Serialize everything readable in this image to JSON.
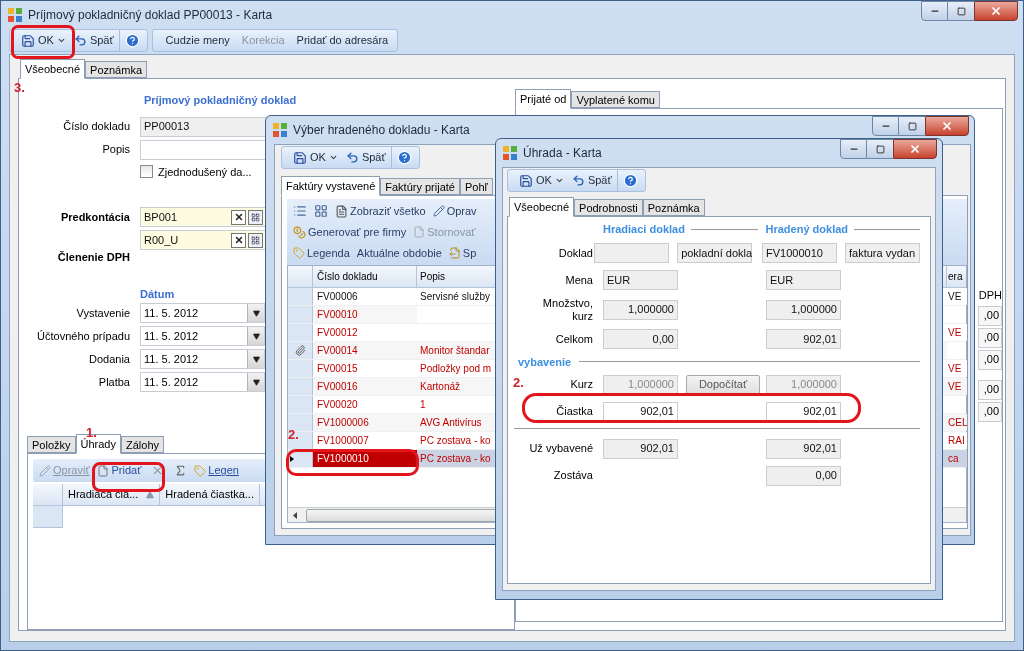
{
  "main_window": {
    "title": "Príjmový pokladničný doklad PP00013 - Karta",
    "toolbar": [
      [
        {
          "kind": "save",
          "label": "OK"
        },
        {
          "kind": "undo",
          "label": "Späť"
        },
        {
          "kind": "help"
        }
      ],
      [
        {
          "kind": "text",
          "label": "Cudzie meny",
          "disabled": false
        },
        {
          "kind": "text",
          "label": "Korekcia",
          "disabled": true
        },
        {
          "kind": "text",
          "label": "Pridať do adresára",
          "disabled": false
        }
      ]
    ],
    "tabs": [
      {
        "label": "Všeobecné",
        "selected": true
      },
      {
        "label": "Poznámka",
        "selected": false
      }
    ],
    "section_title": "Príjmový pokladničný doklad",
    "fields": [
      {
        "label": "Číslo dokladu",
        "value": "PP00013",
        "editable": false
      },
      {
        "label": "Popis",
        "editable": true
      }
    ],
    "checkbox": {
      "label": "Zjednodušený da...",
      "checked": false
    },
    "predkontacia": {
      "label": "Predkontácia",
      "values": [
        "BP001",
        "R00_U"
      ]
    },
    "clenenie_label": "Členenie DPH",
    "dates": {
      "title": "Dátum",
      "rows": [
        {
          "label": "Vystavenie",
          "value": "11. 5. 2012"
        },
        {
          "label": "Účtovného prípadu",
          "value": "11. 5. 2012"
        },
        {
          "label": "Dodania",
          "value": "11. 5. 2012"
        },
        {
          "label": "Platba",
          "value": "11. 5. 2012"
        }
      ]
    },
    "bottom_tabs": [
      {
        "label": "Položky",
        "selected": false
      },
      {
        "label": "Úhrady",
        "selected": true
      },
      {
        "label": "Zálohy",
        "selected": false
      }
    ],
    "bottom_toolbar": [
      {
        "kind": "edit",
        "label": "Opraviť",
        "disabled": true
      },
      {
        "kind": "new",
        "label": "Pridať",
        "disabled": false
      },
      {
        "kind": "delete",
        "disabled": true
      },
      {
        "kind": "sum",
        "disabled": false
      },
      {
        "kind": "legend",
        "label": "Legen",
        "disabled": false
      }
    ],
    "grid_columns": [
      {
        "label": "Hradiaca čia...",
        "sorted": true
      },
      {
        "label": "Hradená čiastka...",
        "sorted": false
      }
    ],
    "right_tabs": [
      {
        "label": "Prijaté od",
        "selected": true
      },
      {
        "label": "Vyplatené komu",
        "selected": false
      }
    ],
    "right_column": {
      "header": "DPH",
      "values": [
        ",00",
        ",00",
        ",00",
        ",00",
        ",00"
      ]
    }
  },
  "selection_window": {
    "title": "Výber hradeného dokladu - Karta",
    "toolbar": [
      [
        {
          "kind": "save",
          "label": "OK"
        },
        {
          "kind": "undo",
          "label": "Späť"
        },
        {
          "kind": "help"
        }
      ]
    ],
    "tabs": [
      {
        "label": "Faktúry vystavené",
        "selected": true
      },
      {
        "label": "Faktúry prijaté",
        "selected": false
      },
      {
        "label": "Pohľ",
        "selected": false
      }
    ],
    "actions": [
      [
        {
          "kind": "list"
        },
        {
          "kind": "form"
        },
        {
          "kind": "show",
          "label": "Zobraziť všetko"
        },
        {
          "kind": "edit",
          "label": "Oprav"
        }
      ],
      [
        {
          "kind": "generate",
          "label": "Generovať pre firmy"
        },
        {
          "kind": "cancel",
          "label": "Stornovať",
          "disabled": true
        }
      ],
      [
        {
          "kind": "legend",
          "label": "Legenda"
        },
        {
          "kind": "text",
          "label": "Aktuálne obdobie"
        },
        {
          "kind": "doc",
          "label": "Sp"
        }
      ]
    ],
    "columns": [
      "Číslo dokladu",
      "Popis",
      "era"
    ],
    "rows": [
      {
        "number": "FV00006",
        "description": "Servisné služby",
        "column_3": "VE",
        "flagged": false,
        "attachment": false,
        "selected": false
      },
      {
        "number": "FV00010",
        "flagged": true,
        "attachment": false,
        "selected": false
      },
      {
        "number": "FV00012",
        "column_3": "VE",
        "flagged": true,
        "attachment": false,
        "selected": false
      },
      {
        "number": "FV00014",
        "description": "Monitor štandar",
        "flagged": true,
        "attachment": true,
        "selected": false
      },
      {
        "number": "FV00015",
        "description": "Podložky pod m",
        "column_3": "VE",
        "flagged": true,
        "attachment": false,
        "selected": false
      },
      {
        "number": "FV00016",
        "description": "Kartonáž",
        "column_3": "VE",
        "flagged": true,
        "attachment": false,
        "selected": false
      },
      {
        "number": "FV00020",
        "description": "1",
        "flagged": true,
        "attachment": false,
        "selected": false
      },
      {
        "number": "FV1000006",
        "description": "AVG Antivírus",
        "column_3": "CEL",
        "flagged": true,
        "attachment": false,
        "selected": false
      },
      {
        "number": "FV1000007",
        "description": "PC zostava - ko",
        "column_3": "RAI",
        "flagged": true,
        "attachment": false,
        "selected": false
      },
      {
        "number": "FV1000010",
        "description": "PC zostava - ko",
        "column_3": "ca",
        "flagged": true,
        "attachment": false,
        "selected": true
      }
    ]
  },
  "payment_window": {
    "title": "Úhrada - Karta",
    "toolbar": [
      [
        {
          "kind": "save",
          "label": "OK"
        },
        {
          "kind": "undo",
          "label": "Späť"
        },
        {
          "kind": "help"
        }
      ]
    ],
    "tabs": [
      {
        "label": "Všeobecné",
        "selected": true
      },
      {
        "label": "Podrobnosti",
        "selected": false
      },
      {
        "label": "Poznámka",
        "selected": false
      }
    ],
    "headers": [
      "Hradiaci doklad",
      "Hradený doklad"
    ],
    "rows": [
      {
        "kind": "text",
        "label": "Doklad",
        "paying": {
          "extra": "pokladní dokla"
        },
        "paid": {
          "value": "FV1000010",
          "extra": "faktura vydan"
        }
      },
      {
        "kind": "text",
        "label": "Mena",
        "paying": {
          "value": "EUR"
        },
        "paid": {
          "value": "EUR"
        }
      },
      {
        "kind": "number",
        "label": "Množstvo, kurz",
        "paying": {
          "value": "1,000000"
        },
        "paid": {
          "value": "1,000000"
        }
      },
      {
        "kind": "number",
        "label": "Celkom",
        "paying": {
          "value": "0,00"
        },
        "paid": {
          "value": "902,01"
        }
      },
      {
        "kind": "section",
        "label": "vybavenie"
      },
      {
        "kind": "number",
        "label": "Kurz",
        "disabled": true,
        "paying": {
          "value": "1,000000"
        },
        "button": "Dopočítať",
        "paid": {
          "value": "1,000000"
        }
      },
      {
        "kind": "number",
        "label": "Čiastka",
        "editable": true,
        "paying": {
          "value": "902,01"
        },
        "paid": {
          "value": "902,01"
        }
      },
      {
        "kind": "divider"
      },
      {
        "kind": "number",
        "label": "Už vybavené",
        "paying": {
          "value": "902,01"
        },
        "paid": {
          "value": "902,01"
        }
      },
      {
        "kind": "number",
        "label": "Zostáva",
        "paid": {
          "value": "0,00"
        }
      }
    ]
  },
  "annotations": [
    "3.",
    "1.",
    "2.",
    "2."
  ]
}
